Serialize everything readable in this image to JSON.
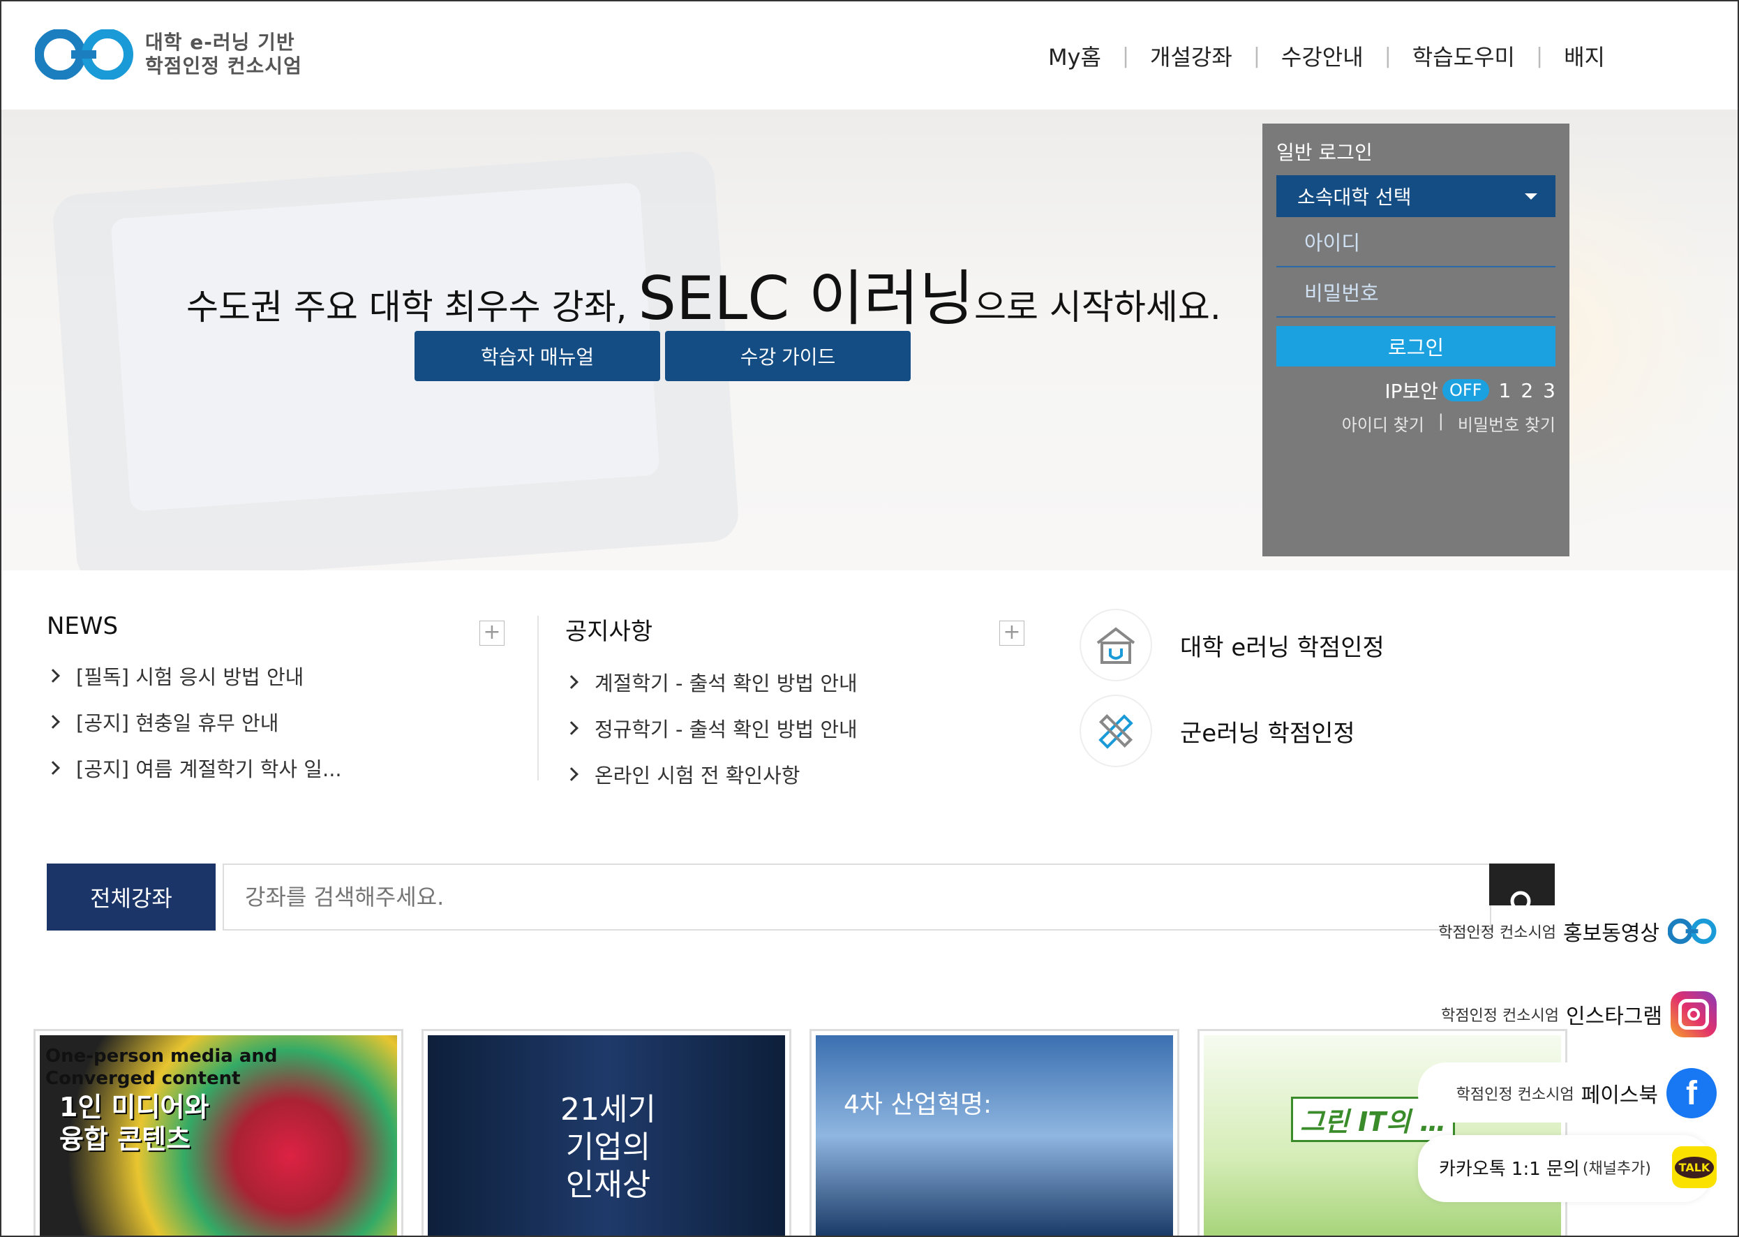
{
  "logo": {
    "line1": "대학 e-러닝 기반",
    "line2": "학점인정 컨소시엄"
  },
  "nav": [
    "My홈",
    "개설강좌",
    "수강안내",
    "학습도우미",
    "배지"
  ],
  "hero": {
    "title_pre": "수도권 주요 대학 최우수 강좌,",
    "title_big": "SELC 이러닝",
    "title_post": "으로 시작하세요.",
    "btn_manual": "학습자 매뉴얼",
    "btn_guide": "수강 가이드"
  },
  "login": {
    "title": "일반 로그인",
    "school_select": "소속대학 선택",
    "id_placeholder": "아이디",
    "pw_placeholder": "비밀번호",
    "login_btn": "로그인",
    "ip_label": "IP보안",
    "ip_state": "OFF",
    "levels": [
      "1",
      "2",
      "3"
    ],
    "find_id": "아이디 찾기",
    "find_pw": "비밀번호 찾기"
  },
  "news": {
    "title": "NEWS",
    "items": [
      "[필독] 시험 응시 방법 안내",
      "[공지] 현충일 휴무 안내",
      "[공지] 여름 계절학기 학사 일..."
    ]
  },
  "notice": {
    "title": "공지사항",
    "items": [
      "계절학기 - 출석 확인 방법 안내",
      "정규학기 - 출석 확인 방법 안내",
      "온라인 시험 전 확인사항"
    ]
  },
  "quick": [
    "대학 e러닝 학점인정",
    "군e러닝 학점인정"
  ],
  "search": {
    "tab": "전체강좌",
    "placeholder": "강좌를 검색해주세요."
  },
  "cards": {
    "c1_en1": "One-person media and",
    "c1_en2": "Converged content",
    "c1_ko1": "1인 미디어와",
    "c1_ko2": "융합 콘텐츠",
    "c2_l1": "21세기",
    "c2_l2": "기업의",
    "c2_l3": "인재상",
    "c3": "4차 산업혁명:",
    "c4": "그린 IT의 …"
  },
  "side": {
    "video_small": "학점인정 컨소시엄",
    "video_main": "홍보동영상",
    "insta_small": "학점인정 컨소시엄",
    "insta_main": "인스타그램",
    "fb_small": "학점인정 컨소시엄",
    "fb_main": "페이스북",
    "kakao_main": "카카오톡 1:1 문의",
    "kakao_sub": "(채널추가)",
    "talk_icon": "TALK"
  },
  "colors": {
    "navy": "#144d84",
    "accent": "#1ba1e0",
    "dark_navy": "#1b3569",
    "login_bg": "#7a7a7a"
  }
}
